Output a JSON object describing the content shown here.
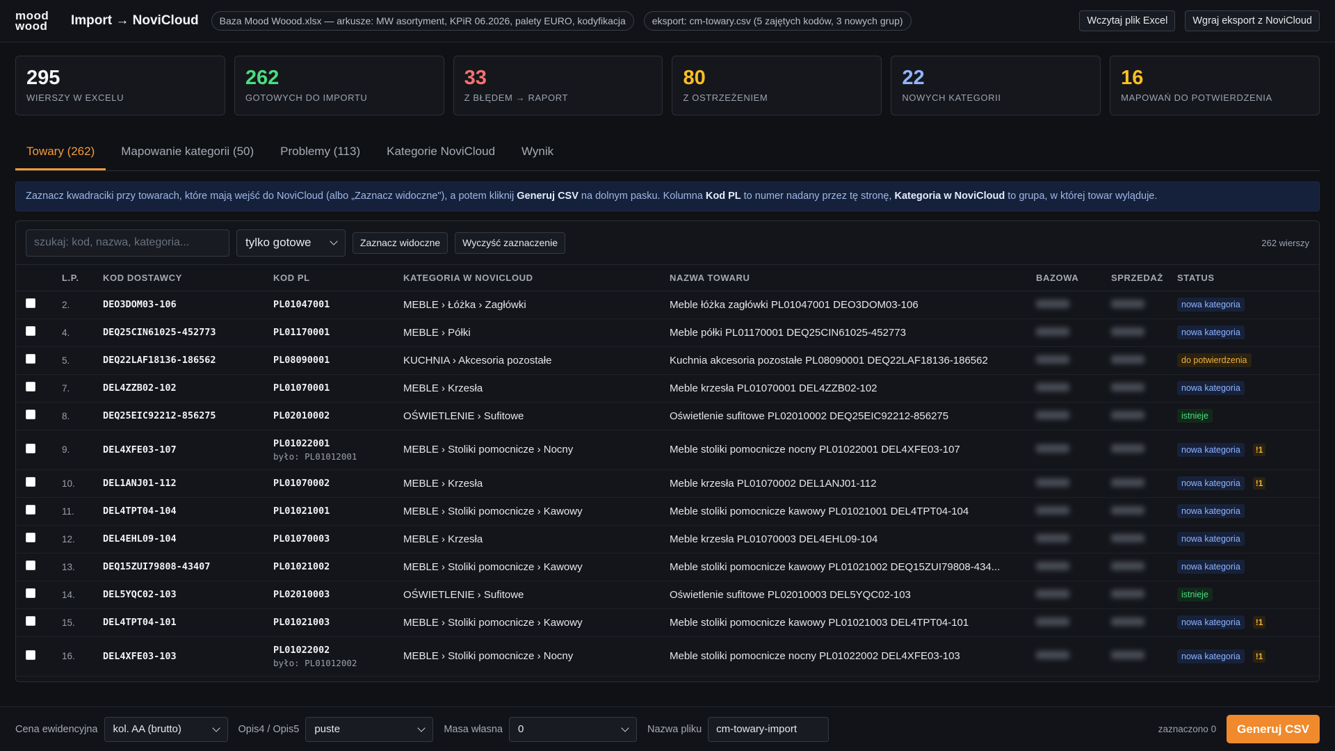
{
  "header": {
    "logo_line1": "mood",
    "logo_line2": "wood",
    "title": "Import → NoviCloud",
    "file_pill": "Baza Mood Woood.xlsx — arkusze: MW asortyment, KPiR 06.2026, palety EURO, kodyfikacja",
    "export_pill": "eksport: cm-towary.csv (5 zajętych kodów, 3 nowych grup)",
    "btn_load_excel": "Wczytaj plik Excel",
    "btn_load_export": "Wgraj eksport z NoviCloud"
  },
  "stats": [
    {
      "value": "295",
      "label": "WIERSZY W EXCELU",
      "color": "#f3f4f6"
    },
    {
      "value": "262",
      "label": "GOTOWYCH DO IMPORTU",
      "color": "#4ade80"
    },
    {
      "value": "33",
      "label": "Z BŁĘDEM → RAPORT",
      "color": "#f87171"
    },
    {
      "value": "80",
      "label": "Z OSTRZEŻENIEM",
      "color": "#fbbf24"
    },
    {
      "value": "22",
      "label": "NOWYCH KATEGORII",
      "color": "#93b4ff"
    },
    {
      "value": "16",
      "label": "MAPOWAŃ DO POTWIERDZENIA",
      "color": "#fbbf24"
    }
  ],
  "tabs": [
    {
      "label": "Towary (262)",
      "active": true
    },
    {
      "label": "Mapowanie kategorii (50)",
      "active": false
    },
    {
      "label": "Problemy (113)",
      "active": false
    },
    {
      "label": "Kategorie NoviCloud",
      "active": false
    },
    {
      "label": "Wynik",
      "active": false
    }
  ],
  "info": {
    "t1": "Zaznacz kwadraciki przy towarach, które mają wejść do NoviCloud (albo „Zaznacz widoczne\"), a potem kliknij ",
    "b1": "Generuj CSV",
    "t2": " na dolnym pasku. Kolumna ",
    "b2": "Kod PL",
    "t3": " to numer nadany przez tę stronę, ",
    "b3": "Kategoria w NoviCloud",
    "t4": " to grupa, w której towar wyląduje."
  },
  "filters": {
    "search_placeholder": "szukaj: kod, nazwa, kategoria...",
    "filter_select": "tylko gotowe",
    "btn_select_visible": "Zaznacz widoczne",
    "btn_clear": "Wyczyść zaznaczenie",
    "row_count": "262 wierszy"
  },
  "table": {
    "columns": [
      "L.P.",
      "KOD DOSTAWCY",
      "KOD PL",
      "KATEGORIA W NOVICLOUD",
      "NAZWA TOWARU",
      "BAZOWA",
      "SPRZEDAŻ",
      "STATUS"
    ],
    "rows": [
      {
        "lp": "2.",
        "kod": "DEO3DOM03-106",
        "pl": "PL01047001",
        "bylo": "",
        "kat": "MEBLE › Łóżka › Zagłówki",
        "nazwa": "Meble łóżka zagłówki PL01047001 DEO3DOM03-106",
        "status": "nowa kategoria",
        "stype": "new",
        "warn": ""
      },
      {
        "lp": "4.",
        "kod": "DEQ25CIN61025-452773",
        "pl": "PL01170001",
        "bylo": "",
        "kat": "MEBLE › Półki",
        "nazwa": "Meble półki PL01170001 DEQ25CIN61025-452773",
        "status": "nowa kategoria",
        "stype": "new",
        "warn": ""
      },
      {
        "lp": "5.",
        "kod": "DEQ22LAF18136-186562",
        "pl": "PL08090001",
        "bylo": "",
        "kat": "KUCHNIA › Akcesoria pozostałe",
        "nazwa": "Kuchnia akcesoria pozostałe PL08090001 DEQ22LAF18136-186562",
        "status": "do potwierdzenia",
        "stype": "pot",
        "warn": ""
      },
      {
        "lp": "7.",
        "kod": "DEL4ZZB02-102",
        "pl": "PL01070001",
        "bylo": "",
        "kat": "MEBLE › Krzesła",
        "nazwa": "Meble krzesła PL01070001 DEL4ZZB02-102",
        "status": "nowa kategoria",
        "stype": "new",
        "warn": ""
      },
      {
        "lp": "8.",
        "kod": "DEQ25EIC92212-856275",
        "pl": "PL02010002",
        "bylo": "",
        "kat": "OŚWIETLENIE › Sufitowe",
        "nazwa": "Oświetlenie sufitowe PL02010002 DEQ25EIC92212-856275",
        "status": "istnieje",
        "stype": "ist",
        "warn": ""
      },
      {
        "lp": "9.",
        "kod": "DEL4XFE03-107",
        "pl": "PL01022001",
        "bylo": "było: PL01012001",
        "kat": "MEBLE › Stoliki pomocnicze › Nocny",
        "nazwa": "Meble stoliki pomocnicze nocny PL01022001 DEL4XFE03-107",
        "status": "nowa kategoria",
        "stype": "new",
        "warn": "!1"
      },
      {
        "lp": "10.",
        "kod": "DEL1ANJ01-112",
        "pl": "PL01070002",
        "bylo": "",
        "kat": "MEBLE › Krzesła",
        "nazwa": "Meble krzesła PL01070002 DEL1ANJ01-112",
        "status": "nowa kategoria",
        "stype": "new",
        "warn": "!1"
      },
      {
        "lp": "11.",
        "kod": "DEL4TPT04-104",
        "pl": "PL01021001",
        "bylo": "",
        "kat": "MEBLE › Stoliki pomocnicze › Kawowy",
        "nazwa": "Meble stoliki pomocnicze kawowy PL01021001 DEL4TPT04-104",
        "status": "nowa kategoria",
        "stype": "new",
        "warn": ""
      },
      {
        "lp": "12.",
        "kod": "DEL4EHL09-104",
        "pl": "PL01070003",
        "bylo": "",
        "kat": "MEBLE › Krzesła",
        "nazwa": "Meble krzesła PL01070003 DEL4EHL09-104",
        "status": "nowa kategoria",
        "stype": "new",
        "warn": ""
      },
      {
        "lp": "13.",
        "kod": "DEQ15ZUI79808-43407",
        "pl": "PL01021002",
        "bylo": "",
        "kat": "MEBLE › Stoliki pomocnicze › Kawowy",
        "nazwa": "Meble stoliki pomocnicze kawowy PL01021002 DEQ15ZUI79808-434...",
        "status": "nowa kategoria",
        "stype": "new",
        "warn": ""
      },
      {
        "lp": "14.",
        "kod": "DEL5YQC02-103",
        "pl": "PL02010003",
        "bylo": "",
        "kat": "OŚWIETLENIE › Sufitowe",
        "nazwa": "Oświetlenie sufitowe PL02010003 DEL5YQC02-103",
        "status": "istnieje",
        "stype": "ist",
        "warn": ""
      },
      {
        "lp": "15.",
        "kod": "DEL4TPT04-101",
        "pl": "PL01021003",
        "bylo": "",
        "kat": "MEBLE › Stoliki pomocnicze › Kawowy",
        "nazwa": "Meble stoliki pomocnicze kawowy PL01021003 DEL4TPT04-101",
        "status": "nowa kategoria",
        "stype": "new",
        "warn": "!1"
      },
      {
        "lp": "16.",
        "kod": "DEL4XFE03-103",
        "pl": "PL01022002",
        "bylo": "było: PL01012002",
        "kat": "MEBLE › Stoliki pomocnicze › Nocny",
        "nazwa": "Meble stoliki pomocnicze nocny PL01022002 DEL4XFE03-103",
        "status": "nowa kategoria",
        "stype": "new",
        "warn": "!1"
      }
    ]
  },
  "footer": {
    "price_label": "Cena ewidencyjna",
    "price_value": "kol. AA (brutto)",
    "opis_label": "Opis4 / Opis5",
    "opis_value": "puste",
    "masa_label": "Masa własna",
    "masa_value": "0",
    "file_label": "Nazwa pliku",
    "file_value": "cm-towary-import",
    "selected": "zaznaczono 0",
    "generate": "Generuj CSV"
  }
}
